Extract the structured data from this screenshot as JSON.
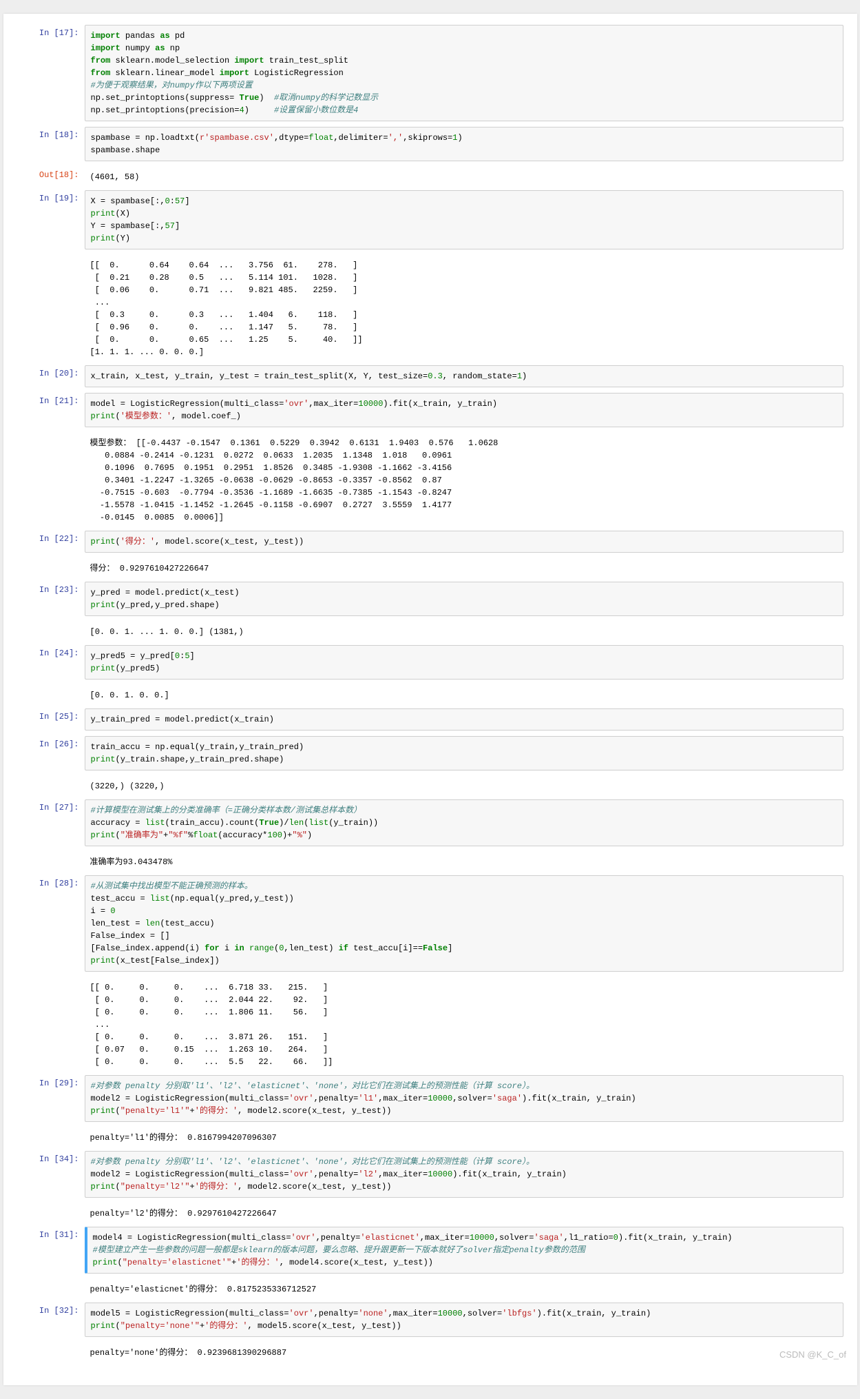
{
  "watermark": "CSDN @K_C_of",
  "cells": [
    {
      "prompt_in": "In  [17]:",
      "code_html": "<span class='k-green'>import</span> pandas <span class='k-green'>as</span> pd\n<span class='k-green'>import</span> numpy <span class='k-green'>as</span> np\n<span class='k-green'>from</span> sklearn.model_selection <span class='k-green'>import</span> train_test_split\n<span class='k-green'>from</span> sklearn.linear_model <span class='k-green'>import</span> LogisticRegression\n<span class='k-comment'>#为便于观察结果，对numpy作以下两项设置</span>\nnp.set_printoptions(suppress= <span class='k-green'>True</span>)  <span class='k-comment'>#取消numpy的科学记数显示</span>\nnp.set_printoptions(precision=<span class='k-num'>4</span>)     <span class='k-comment'>#设置保留小数位数是4</span>"
    },
    {
      "prompt_in": "In  [18]:",
      "code_html": "spambase = np.loadtxt(<span class='k-str'>r'spambase.csv'</span>,dtype=<span class='k-builtin'>float</span>,delimiter=<span class='k-str'>','</span>,skiprows=<span class='k-num'>1</span>)\nspambase.shape",
      "out_prompt": "Out[18]:",
      "output": "(4601, 58)"
    },
    {
      "prompt_in": "In  [19]:",
      "code_html": "X = spambase[:,<span class='k-num'>0</span>:<span class='k-num'>57</span>]\n<span class='k-builtin'>print</span>(X)\nY = spambase[:,<span class='k-num'>57</span>]\n<span class='k-builtin'>print</span>(Y)",
      "output": "[[  0.      0.64    0.64  ...   3.756  61.    278.   ]\n [  0.21    0.28    0.5   ...   5.114 101.   1028.   ]\n [  0.06    0.      0.71  ...   9.821 485.   2259.   ]\n ...\n [  0.3     0.      0.3   ...   1.404   6.    118.   ]\n [  0.96    0.      0.    ...   1.147   5.     78.   ]\n [  0.      0.      0.65  ...   1.25    5.     40.   ]]\n[1. 1. 1. ... 0. 0. 0.]"
    },
    {
      "prompt_in": "In  [20]:",
      "code_html": "x_train, x_test, y_train, y_test = train_test_split(X, Y, test_size=<span class='k-num'>0.3</span>, random_state=<span class='k-num'>1</span>)"
    },
    {
      "prompt_in": "In  [21]:",
      "code_html": "model = LogisticRegression(multi_class=<span class='k-str'>'ovr'</span>,max_iter=<span class='k-num'>10000</span>).fit(x_train, y_train)\n<span class='k-builtin'>print</span>(<span class='k-str'>'模型参数：'</span>, model.coef_)",
      "output": "模型参数： [[-0.4437 -0.1547  0.1361  0.5229  0.3942  0.6131  1.9403  0.576   1.0628\n   0.0884 -0.2414 -0.1231  0.0272  0.0633  1.2035  1.1348  1.018   0.0961\n   0.1096  0.7695  0.1951  0.2951  1.8526  0.3485 -1.9308 -1.1662 -3.4156\n   0.3401 -1.2247 -1.3265 -0.0638 -0.0629 -0.8653 -0.3357 -0.8562  0.87\n  -0.7515 -0.603  -0.7794 -0.3536 -1.1689 -1.6635 -0.7385 -1.1543 -0.8247\n  -1.5578 -1.0415 -1.1452 -1.2645 -0.1158 -0.6907  0.2727  3.5559  1.4177\n  -0.0145  0.0085  0.0006]]"
    },
    {
      "prompt_in": "In  [22]:",
      "code_html": "<span class='k-builtin'>print</span>(<span class='k-str'>'得分：'</span>, model.score(x_test, y_test))",
      "output": "得分： 0.9297610427226647"
    },
    {
      "prompt_in": "In  [23]:",
      "code_html": "y_pred = model.predict(x_test)\n<span class='k-builtin'>print</span>(y_pred,y_pred.shape)",
      "output": "[0. 0. 1. ... 1. 0. 0.] (1381,)"
    },
    {
      "prompt_in": "In  [24]:",
      "code_html": "y_pred5 = y_pred[<span class='k-num'>0</span>:<span class='k-num'>5</span>]\n<span class='k-builtin'>print</span>(y_pred5)",
      "output": "[0. 0. 1. 0. 0.]"
    },
    {
      "prompt_in": "In  [25]:",
      "code_html": "y_train_pred = model.predict(x_train)"
    },
    {
      "prompt_in": "In  [26]:",
      "code_html": "train_accu = np.equal(y_train,y_train_pred)\n<span class='k-builtin'>print</span>(y_train.shape,y_train_pred.shape)",
      "output": "(3220,) (3220,)"
    },
    {
      "prompt_in": "In  [27]:",
      "code_html": "<span class='k-comment'>#计算模型在测试集上的分类准确率（=正确分类样本数/测试集总样本数）</span>\naccuracy = <span class='k-builtin'>list</span>(train_accu).count(<span class='k-green'>True</span>)/<span class='k-builtin'>len</span>(<span class='k-builtin'>list</span>(y_train))\n<span class='k-builtin'>print</span>(<span class='k-str'>\"准确率为\"</span>+<span class='k-str'>\"%f\"</span>%<span class='k-builtin'>float</span>(accuracy*<span class='k-num'>100</span>)+<span class='k-str'>\"%\"</span>)",
      "output": "准确率为93.043478%"
    },
    {
      "prompt_in": "In  [28]:",
      "code_html": "<span class='k-comment'>#从测试集中找出模型不能正确预测的样本。</span>\ntest_accu = <span class='k-builtin'>list</span>(np.equal(y_pred,y_test))\ni = <span class='k-num'>0</span>\nlen_test = <span class='k-builtin'>len</span>(test_accu)\nFalse_index = []\n[False_index.append(i) <span class='k-green'>for</span> i <span class='k-green'>in</span> <span class='k-builtin'>range</span>(<span class='k-num'>0</span>,len_test) <span class='k-green'>if</span> test_accu[i]==<span class='k-green'>False</span>]\n<span class='k-builtin'>print</span>(x_test[False_index])",
      "output": "[[ 0.     0.     0.    ...  6.718 33.   215.   ]\n [ 0.     0.     0.    ...  2.044 22.    92.   ]\n [ 0.     0.     0.    ...  1.806 11.    56.   ]\n ...\n [ 0.     0.     0.    ...  3.871 26.   151.   ]\n [ 0.07   0.     0.15  ...  1.263 10.   264.   ]\n [ 0.     0.     0.    ...  5.5   22.    66.   ]]"
    },
    {
      "prompt_in": "In  [29]:",
      "code_html": "<span class='k-comment'>#对参数 penalty 分别取'l1'、'l2'、'elasticnet'、'none'，对比它们在测试集上的预测性能（计算 score）。</span>\nmodel2 = LogisticRegression(multi_class=<span class='k-str'>'ovr'</span>,penalty=<span class='k-str'>'l1'</span>,max_iter=<span class='k-num'>10000</span>,solver=<span class='k-str'>'saga'</span>).fit(x_train, y_train)\n<span class='k-builtin'>print</span>(<span class='k-str'>\"penalty='l1'\"</span>+<span class='k-str'>'的得分：'</span>, model2.score(x_test, y_test))",
      "output": "penalty='l1'的得分： 0.8167994207096307"
    },
    {
      "prompt_in": "In  [34]:",
      "code_html": "<span class='k-comment'>#对参数 penalty 分别取'l1'、'l2'、'elasticnet'、'none'，对比它们在测试集上的预测性能（计算 score）。</span>\nmodel2 = LogisticRegression(multi_class=<span class='k-str'>'ovr'</span>,penalty=<span class='k-str'>'l2'</span>,max_iter=<span class='k-num'>10000</span>).fit(x_train, y_train)\n<span class='k-builtin'>print</span>(<span class='k-str'>\"penalty='l2'\"</span>+<span class='k-str'>'的得分：'</span>, model2.score(x_test, y_test))",
      "output": "penalty='l2'的得分： 0.9297610427226647"
    },
    {
      "prompt_in": "In  [31]:",
      "selected": true,
      "code_html": "model4 = LogisticRegression(multi_class=<span class='k-str'>'ovr'</span>,penalty=<span class='k-str'>'elasticnet'</span>,max_iter=<span class='k-num'>10000</span>,solver=<span class='k-str'>'saga'</span>,l1_ratio=<span class='k-num'>0</span>).fit(x_train, y_train)\n<span class='k-comment'>#模型建立产生一些参数的问题一般都是sklearn的版本问题，要么忽略、提升跟更新一下版本就好了solver指定penalty参数的范围</span>\n<span class='k-builtin'>print</span>(<span class='k-str'>\"penalty='elasticnet'\"</span>+<span class='k-str'>'的得分：'</span>, model4.score(x_test, y_test))",
      "output": "penalty='elasticnet'的得分： 0.8175235336712527"
    },
    {
      "prompt_in": "In  [32]:",
      "code_html": "model5 = LogisticRegression(multi_class=<span class='k-str'>'ovr'</span>,penalty=<span class='k-str'>'none'</span>,max_iter=<span class='k-num'>10000</span>,solver=<span class='k-str'>'lbfgs'</span>).fit(x_train, y_train)\n<span class='k-builtin'>print</span>(<span class='k-str'>\"penalty='none'\"</span>+<span class='k-str'>'的得分：'</span>, model5.score(x_test, y_test))",
      "output": "penalty='none'的得分： 0.9239681390296887"
    }
  ]
}
